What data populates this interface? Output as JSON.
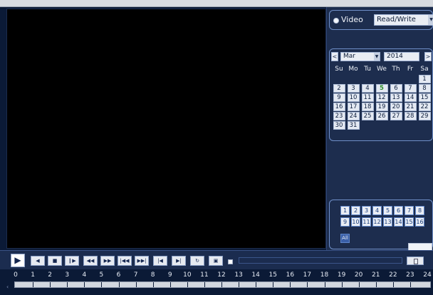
{
  "mode": {
    "type_label": "Video",
    "access_value": "Read/Write"
  },
  "calendar": {
    "prev_label": "<",
    "next_label": ">",
    "month": "Mar",
    "year": "2014",
    "weekdays": [
      "Su",
      "Mo",
      "Tu",
      "We",
      "Th",
      "Fr",
      "Sa"
    ],
    "days": [
      "",
      "",
      "",
      "",
      "",
      "",
      "1",
      "2",
      "3",
      "4",
      "5",
      "6",
      "7",
      "8",
      "9",
      "10",
      "11",
      "12",
      "13",
      "14",
      "15",
      "16",
      "17",
      "18",
      "19",
      "20",
      "21",
      "22",
      "23",
      "24",
      "25",
      "26",
      "27",
      "28",
      "29",
      "30",
      "31",
      "",
      "",
      "",
      "",
      ""
    ],
    "highlighted_day": "5",
    "highlight_color": "#2f8f2a"
  },
  "channels": {
    "items": [
      "1",
      "2",
      "3",
      "4",
      "5",
      "6",
      "7",
      "8",
      "9",
      "10",
      "11",
      "12",
      "13",
      "14",
      "15",
      "16"
    ],
    "all_label": "All"
  },
  "playback": {
    "play_icon": "play-icon",
    "buttons": [
      {
        "name": "prev-frame-button",
        "glyph": "◀",
        "icon": "step-back-icon"
      },
      {
        "name": "stop-button",
        "glyph": "■",
        "icon": "stop-icon"
      },
      {
        "name": "slow-play-button",
        "glyph": "❙▶",
        "icon": "slow-play-icon"
      },
      {
        "name": "fast-backward-button",
        "glyph": "◀◀",
        "icon": "rewind-icon"
      },
      {
        "name": "fast-forward-button",
        "glyph": "▶▶",
        "icon": "fast-forward-icon"
      },
      {
        "name": "previous-file-button",
        "glyph": "|◀◀",
        "icon": "skip-back-icon"
      },
      {
        "name": "next-file-button",
        "glyph": "▶▶|",
        "icon": "skip-forward-icon"
      },
      {
        "name": "previous-frame-button",
        "glyph": "|◀",
        "icon": "frame-back-icon"
      },
      {
        "name": "next-frame-button",
        "glyph": "▶|",
        "icon": "frame-forward-icon"
      },
      {
        "name": "loop-button",
        "glyph": "↻",
        "icon": "loop-icon"
      },
      {
        "name": "snapshot-button",
        "glyph": "▣",
        "icon": "snapshot-icon"
      }
    ]
  },
  "timeline": {
    "hours": [
      "0",
      "1",
      "2",
      "3",
      "4",
      "5",
      "6",
      "7",
      "8",
      "9",
      "10",
      "11",
      "12",
      "13",
      "14",
      "15",
      "16",
      "17",
      "18",
      "19",
      "20",
      "21",
      "22",
      "23",
      "24"
    ]
  }
}
